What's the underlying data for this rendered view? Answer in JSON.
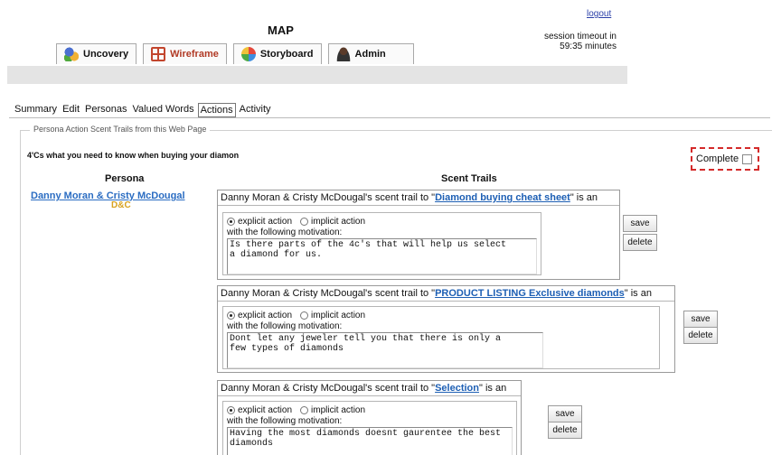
{
  "header": {
    "title": "MAP",
    "logout": "logout",
    "session_line1": "session timeout in",
    "session_line2": "59:35 minutes"
  },
  "main_tabs": [
    {
      "label": "Uncovery",
      "icon": "people-icon"
    },
    {
      "label": "Wireframe",
      "icon": "wireframe-icon",
      "active": true
    },
    {
      "label": "Storyboard",
      "icon": "storyboard-icon"
    },
    {
      "label": "Admin",
      "icon": "admin-icon"
    }
  ],
  "sub_tabs": [
    "Summary",
    "Edit",
    "Personas",
    "Valued Words",
    "Actions",
    "Activity"
  ],
  "active_sub_tab": "Actions",
  "section_legend": "Persona Action Scent Trails from this Web Page",
  "page_heading": "4'Cs what you need to know when buying your diamon",
  "complete_label": "Complete",
  "columns": {
    "persona": "Persona",
    "trails": "Scent Trails"
  },
  "persona": {
    "name": "Danny Moran & Cristy McDougal",
    "abbr": "D&C"
  },
  "trail_common": {
    "prefix": "Danny Moran & Cristy McDougal's scent trail to \"",
    "suffix": "\" is an",
    "explicit": "explicit action",
    "implicit": "implicit action",
    "motivation_label": "with the following motivation:",
    "save": "save",
    "delete": "delete"
  },
  "trails": [
    {
      "target": "Diamond buying cheat sheet",
      "selected": "explicit",
      "motivation": "Is there parts of the 4c's that will help us select\na diamond for us."
    },
    {
      "target": "PRODUCT LISTING Exclusive diamonds",
      "selected": "explicit",
      "motivation": "Dont let any jeweler tell you that there is only a\nfew types of diamonds"
    },
    {
      "target": "Selection",
      "selected": "explicit",
      "motivation": "Having the most diamonds doesnt gaurentee the best\ndiamonds"
    }
  ]
}
